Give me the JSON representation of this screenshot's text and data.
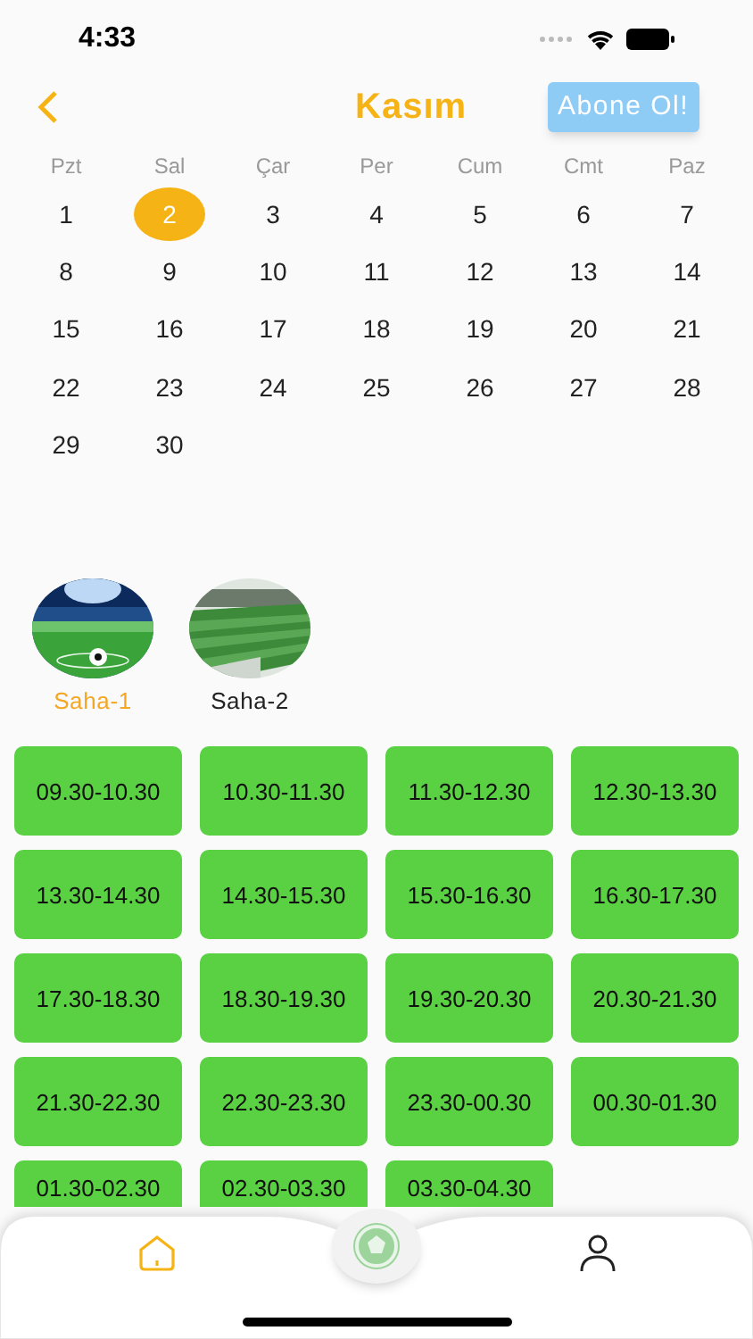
{
  "status_bar": {
    "time": "4:33"
  },
  "header": {
    "title": "Kasım",
    "subscribe_button": "Abone Ol!"
  },
  "calendar": {
    "weekdays": [
      "Pzt",
      "Sal",
      "Çar",
      "Per",
      "Cum",
      "Cmt",
      "Paz"
    ],
    "days": [
      {
        "label": "1",
        "selected": false
      },
      {
        "label": "2",
        "selected": true
      },
      {
        "label": "3",
        "selected": false
      },
      {
        "label": "4",
        "selected": false
      },
      {
        "label": "5",
        "selected": false
      },
      {
        "label": "6",
        "selected": false
      },
      {
        "label": "7",
        "selected": false
      },
      {
        "label": "8",
        "selected": false
      },
      {
        "label": "9",
        "selected": false
      },
      {
        "label": "10",
        "selected": false
      },
      {
        "label": "11",
        "selected": false
      },
      {
        "label": "12",
        "selected": false
      },
      {
        "label": "13",
        "selected": false
      },
      {
        "label": "14",
        "selected": false
      },
      {
        "label": "15",
        "selected": false
      },
      {
        "label": "16",
        "selected": false
      },
      {
        "label": "17",
        "selected": false
      },
      {
        "label": "18",
        "selected": false
      },
      {
        "label": "19",
        "selected": false
      },
      {
        "label": "20",
        "selected": false
      },
      {
        "label": "21",
        "selected": false
      },
      {
        "label": "22",
        "selected": false
      },
      {
        "label": "23",
        "selected": false
      },
      {
        "label": "24",
        "selected": false
      },
      {
        "label": "25",
        "selected": false
      },
      {
        "label": "26",
        "selected": false
      },
      {
        "label": "27",
        "selected": false
      },
      {
        "label": "28",
        "selected": false
      },
      {
        "label": "29",
        "selected": false
      },
      {
        "label": "30",
        "selected": false
      }
    ]
  },
  "fields": [
    {
      "name": "Saha-1",
      "selected": true,
      "kind": "picture"
    },
    {
      "name": "Saha-2",
      "selected": false,
      "kind": "picture"
    }
  ],
  "time_slots": [
    "09.30-10.30",
    "10.30-11.30",
    "11.30-12.30",
    "12.30-13.30",
    "13.30-14.30",
    "14.30-15.30",
    "15.30-16.30",
    "16.30-17.30",
    "17.30-18.30",
    "18.30-19.30",
    "19.30-20.30",
    "20.30-21.30",
    "21.30-22.30",
    "22.30-23.30",
    "23.30-00.30",
    "00.30-01.30",
    "01.30-02.30",
    "02.30-03.30",
    "03.30-04.30"
  ],
  "tab_bar": {
    "tabs": [
      {
        "kind": "home",
        "selected": true
      },
      {
        "kind": "profile",
        "selected": false
      }
    ]
  }
}
